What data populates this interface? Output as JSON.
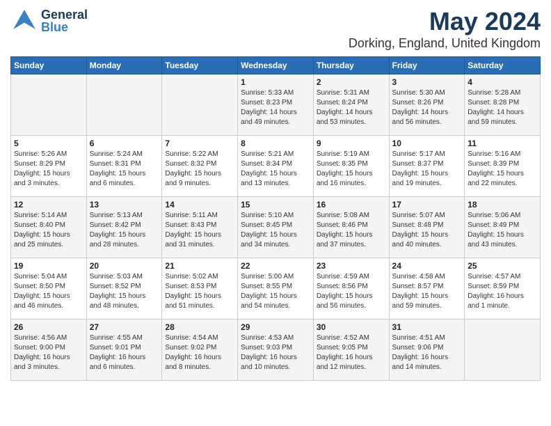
{
  "logo": {
    "general": "General",
    "blue": "Blue"
  },
  "title": "May 2024",
  "subtitle": "Dorking, England, United Kingdom",
  "days_of_week": [
    "Sunday",
    "Monday",
    "Tuesday",
    "Wednesday",
    "Thursday",
    "Friday",
    "Saturday"
  ],
  "weeks": [
    [
      {
        "day": "",
        "content": ""
      },
      {
        "day": "",
        "content": ""
      },
      {
        "day": "",
        "content": ""
      },
      {
        "day": "1",
        "content": "Sunrise: 5:33 AM\nSunset: 8:23 PM\nDaylight: 14 hours\nand 49 minutes."
      },
      {
        "day": "2",
        "content": "Sunrise: 5:31 AM\nSunset: 8:24 PM\nDaylight: 14 hours\nand 53 minutes."
      },
      {
        "day": "3",
        "content": "Sunrise: 5:30 AM\nSunset: 8:26 PM\nDaylight: 14 hours\nand 56 minutes."
      },
      {
        "day": "4",
        "content": "Sunrise: 5:28 AM\nSunset: 8:28 PM\nDaylight: 14 hours\nand 59 minutes."
      }
    ],
    [
      {
        "day": "5",
        "content": "Sunrise: 5:26 AM\nSunset: 8:29 PM\nDaylight: 15 hours\nand 3 minutes."
      },
      {
        "day": "6",
        "content": "Sunrise: 5:24 AM\nSunset: 8:31 PM\nDaylight: 15 hours\nand 6 minutes."
      },
      {
        "day": "7",
        "content": "Sunrise: 5:22 AM\nSunset: 8:32 PM\nDaylight: 15 hours\nand 9 minutes."
      },
      {
        "day": "8",
        "content": "Sunrise: 5:21 AM\nSunset: 8:34 PM\nDaylight: 15 hours\nand 13 minutes."
      },
      {
        "day": "9",
        "content": "Sunrise: 5:19 AM\nSunset: 8:35 PM\nDaylight: 15 hours\nand 16 minutes."
      },
      {
        "day": "10",
        "content": "Sunrise: 5:17 AM\nSunset: 8:37 PM\nDaylight: 15 hours\nand 19 minutes."
      },
      {
        "day": "11",
        "content": "Sunrise: 5:16 AM\nSunset: 8:39 PM\nDaylight: 15 hours\nand 22 minutes."
      }
    ],
    [
      {
        "day": "12",
        "content": "Sunrise: 5:14 AM\nSunset: 8:40 PM\nDaylight: 15 hours\nand 25 minutes."
      },
      {
        "day": "13",
        "content": "Sunrise: 5:13 AM\nSunset: 8:42 PM\nDaylight: 15 hours\nand 28 minutes."
      },
      {
        "day": "14",
        "content": "Sunrise: 5:11 AM\nSunset: 8:43 PM\nDaylight: 15 hours\nand 31 minutes."
      },
      {
        "day": "15",
        "content": "Sunrise: 5:10 AM\nSunset: 8:45 PM\nDaylight: 15 hours\nand 34 minutes."
      },
      {
        "day": "16",
        "content": "Sunrise: 5:08 AM\nSunset: 8:46 PM\nDaylight: 15 hours\nand 37 minutes."
      },
      {
        "day": "17",
        "content": "Sunrise: 5:07 AM\nSunset: 8:48 PM\nDaylight: 15 hours\nand 40 minutes."
      },
      {
        "day": "18",
        "content": "Sunrise: 5:06 AM\nSunset: 8:49 PM\nDaylight: 15 hours\nand 43 minutes."
      }
    ],
    [
      {
        "day": "19",
        "content": "Sunrise: 5:04 AM\nSunset: 8:50 PM\nDaylight: 15 hours\nand 46 minutes."
      },
      {
        "day": "20",
        "content": "Sunrise: 5:03 AM\nSunset: 8:52 PM\nDaylight: 15 hours\nand 48 minutes."
      },
      {
        "day": "21",
        "content": "Sunrise: 5:02 AM\nSunset: 8:53 PM\nDaylight: 15 hours\nand 51 minutes."
      },
      {
        "day": "22",
        "content": "Sunrise: 5:00 AM\nSunset: 8:55 PM\nDaylight: 15 hours\nand 54 minutes."
      },
      {
        "day": "23",
        "content": "Sunrise: 4:59 AM\nSunset: 8:56 PM\nDaylight: 15 hours\nand 56 minutes."
      },
      {
        "day": "24",
        "content": "Sunrise: 4:58 AM\nSunset: 8:57 PM\nDaylight: 15 hours\nand 59 minutes."
      },
      {
        "day": "25",
        "content": "Sunrise: 4:57 AM\nSunset: 8:59 PM\nDaylight: 16 hours\nand 1 minute."
      }
    ],
    [
      {
        "day": "26",
        "content": "Sunrise: 4:56 AM\nSunset: 9:00 PM\nDaylight: 16 hours\nand 3 minutes."
      },
      {
        "day": "27",
        "content": "Sunrise: 4:55 AM\nSunset: 9:01 PM\nDaylight: 16 hours\nand 6 minutes."
      },
      {
        "day": "28",
        "content": "Sunrise: 4:54 AM\nSunset: 9:02 PM\nDaylight: 16 hours\nand 8 minutes."
      },
      {
        "day": "29",
        "content": "Sunrise: 4:53 AM\nSunset: 9:03 PM\nDaylight: 16 hours\nand 10 minutes."
      },
      {
        "day": "30",
        "content": "Sunrise: 4:52 AM\nSunset: 9:05 PM\nDaylight: 16 hours\nand 12 minutes."
      },
      {
        "day": "31",
        "content": "Sunrise: 4:51 AM\nSunset: 9:06 PM\nDaylight: 16 hours\nand 14 minutes."
      },
      {
        "day": "",
        "content": ""
      }
    ]
  ]
}
